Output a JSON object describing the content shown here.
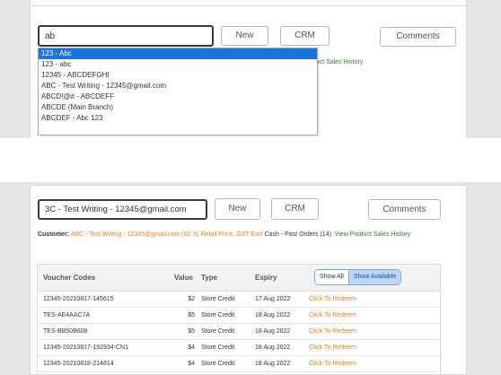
{
  "top": {
    "search_value": "ab",
    "new_label": "New",
    "crm_label": "CRM",
    "comments_label": "Comments",
    "dropdown_options": [
      "123 - Abc",
      "123 - abc",
      "12345 - ABCDEFGHI",
      "ABC - Test Writing - 12345@gmail.com",
      "ABCD!@# - ABCDEFF",
      "ABCDE (Main Branch)",
      "ABCDEF - Abc 123"
    ],
    "partial_history_link": "oduct Sales History"
  },
  "bottom": {
    "search_value": "3C - Test Writing - 12345@gmail.com",
    "new_label": "New",
    "crm_label": "CRM",
    "comments_label": "Comments",
    "customer": {
      "label": "Customer:",
      "detail": "ABC - Test Writing - 12345@gmail.com (ID: 5) Retail Price, GST Excl",
      "payment": "Cash - Past Orders (14).",
      "history_link": "View Product Sales History"
    },
    "table": {
      "headers": {
        "codes": "Voucher Codes",
        "value": "Value",
        "type": "Type",
        "expiry": "Expiry"
      },
      "show_all": "Show All",
      "show_available": "Show Available",
      "rows": [
        {
          "code": "12345-20210817-145615",
          "value": "$2",
          "type": "Store Credit",
          "expiry": "17 Aug 2022",
          "action": "Click To Redeem"
        },
        {
          "code": "TES-AE4AAC7A",
          "value": "$5",
          "type": "Store Credit",
          "expiry": "18 Aug 2022",
          "action": "Click To Redeem"
        },
        {
          "code": "TES-BB50B608",
          "value": "$5",
          "type": "Store Credit",
          "expiry": "18 Aug 2022",
          "action": "Click To Redeem"
        },
        {
          "code": "12345-20210817-192934-CN1",
          "value": "$4",
          "type": "Store Credit",
          "expiry": "18 Aug 2022",
          "action": "Click To Redeem"
        },
        {
          "code": "12345-20210818-214814",
          "value": "$4",
          "type": "Store Credit",
          "expiry": "18 Aug 2022",
          "action": "Click To Redeem"
        }
      ]
    }
  },
  "colors": {
    "selected_option": "#1c73d8",
    "orange_text": "#e67e22",
    "green_link": "#2e7d32",
    "toggle_active": "#bcd6f5"
  }
}
